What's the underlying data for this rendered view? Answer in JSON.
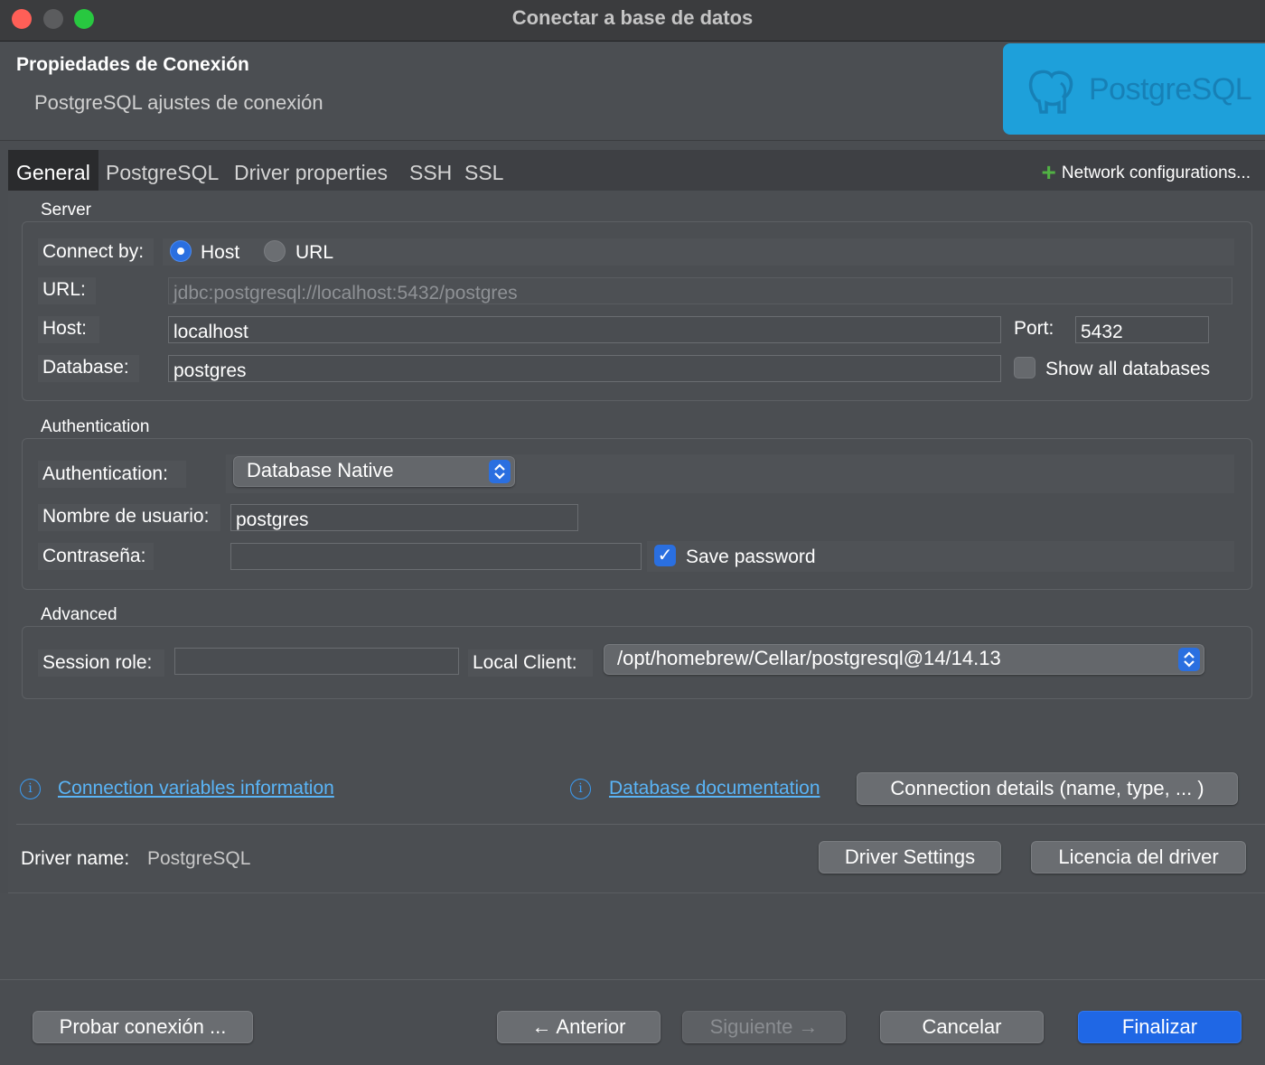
{
  "window": {
    "title": "Conectar a base de datos"
  },
  "header": {
    "title": "Propiedades de Conexión",
    "subtitle": "PostgreSQL ajustes de conexión",
    "logo_text": "PostgreSQL"
  },
  "tabs": [
    {
      "label": "General",
      "active": true
    },
    {
      "label": "PostgreSQL"
    },
    {
      "label": "Driver properties"
    },
    {
      "label": "SSH"
    },
    {
      "label": "SSL"
    }
  ],
  "network_config_label": "Network configurations...",
  "server": {
    "group_label": "Server",
    "connect_by_label": "Connect by:",
    "host_option": "Host",
    "url_option": "URL",
    "connect_by_selected": "Host",
    "url_label": "URL:",
    "url_value": "jdbc:postgresql://localhost:5432/postgres",
    "host_label": "Host:",
    "host_value": "localhost",
    "port_label": "Port:",
    "port_value": "5432",
    "database_label": "Database:",
    "database_value": "postgres",
    "show_all_label": "Show all databases",
    "show_all_checked": false
  },
  "authentication": {
    "group_label": "Authentication",
    "auth_label": "Authentication:",
    "auth_value": "Database Native",
    "username_label": "Nombre de usuario:",
    "username_value": "postgres",
    "password_label": "Contraseña:",
    "password_value": "",
    "save_password_label": "Save password",
    "save_password_checked": true
  },
  "advanced": {
    "group_label": "Advanced",
    "session_role_label": "Session role:",
    "session_role_value": "",
    "local_client_label": "Local Client:",
    "local_client_value": "/opt/homebrew/Cellar/postgresql@14/14.13"
  },
  "links": {
    "connection_variables": "Connection variables information",
    "database_documentation": "Database documentation"
  },
  "connection_details_button": "Connection details (name, type, ... )",
  "driver": {
    "name_label": "Driver name:",
    "name_value": "PostgreSQL",
    "settings_button": "Driver Settings",
    "license_button": "Licencia del driver"
  },
  "footer": {
    "test_button": "Probar conexión ...",
    "back_button": "← Anterior",
    "next_button": "Siguiente →",
    "cancel_button": "Cancelar",
    "finish_button": "Finalizar"
  },
  "colors": {
    "accent": "#1f67e5",
    "link": "#5ab4f6",
    "logo_bg": "#1ea0da",
    "plus_green": "#51b244"
  }
}
